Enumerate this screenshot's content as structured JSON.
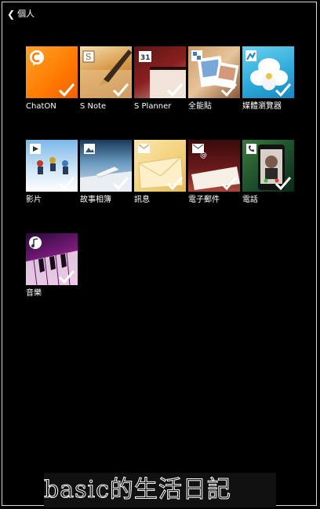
{
  "header": {
    "back_icon": "chevron-left-icon",
    "title": "個人"
  },
  "apps": [
    {
      "id": "chaton",
      "label": "ChatON",
      "badge": "c",
      "selected": true
    },
    {
      "id": "snote",
      "label": "S Note",
      "badge": "S",
      "selected": true
    },
    {
      "id": "splanner",
      "label": "S Planner",
      "badge": "31",
      "selected": true
    },
    {
      "id": "scrapbook",
      "label": "全能貼",
      "badge": "",
      "selected": true
    },
    {
      "id": "browser",
      "label": "媒體瀏覽器",
      "badge": "",
      "selected": true
    },
    {
      "id": "video",
      "label": "影片",
      "badge": "▶",
      "selected": true
    },
    {
      "id": "story",
      "label": "故事相簿",
      "badge": "",
      "selected": true
    },
    {
      "id": "messages",
      "label": "訊息",
      "badge": "✉",
      "selected": true
    },
    {
      "id": "email",
      "label": "電子郵件",
      "badge": "@",
      "selected": true
    },
    {
      "id": "phone",
      "label": "電話",
      "badge": "✆",
      "selected": true
    },
    {
      "id": "music",
      "label": "音樂",
      "badge": "♪",
      "selected": true
    }
  ],
  "watermark": {
    "text": "basic的生活日記"
  }
}
